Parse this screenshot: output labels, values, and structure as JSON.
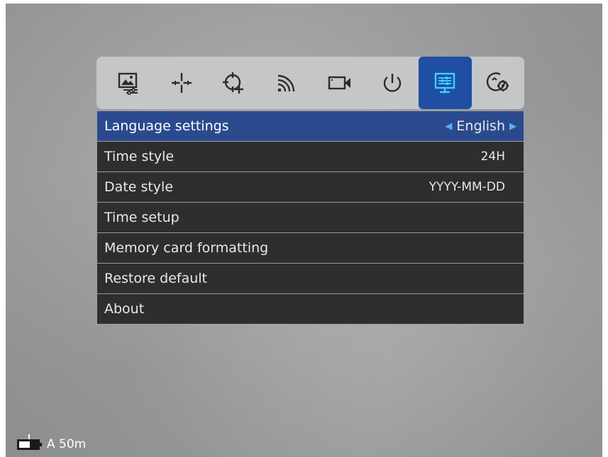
{
  "icons": {
    "tabs": [
      {
        "id": "image",
        "icon": "image-settings-icon"
      },
      {
        "id": "crosshair",
        "icon": "crosshair-icon"
      },
      {
        "id": "target",
        "icon": "target-icon"
      },
      {
        "id": "wifi",
        "icon": "wireless-icon"
      },
      {
        "id": "record",
        "icon": "video-camera-icon"
      },
      {
        "id": "power",
        "icon": "power-icon"
      },
      {
        "id": "display",
        "icon": "display-settings-icon",
        "active": true
      },
      {
        "id": "system",
        "icon": "system-settings-icon"
      }
    ],
    "active_color": "#1e4fa3"
  },
  "menu": {
    "rows": [
      {
        "label": "Language settings",
        "value": "English",
        "selected": true
      },
      {
        "label": "Time style",
        "value": "24H"
      },
      {
        "label": "Date style",
        "value": "YYYY-MM-DD"
      },
      {
        "label": "Time setup",
        "value": ""
      },
      {
        "label": "Memory card formatting",
        "value": ""
      },
      {
        "label": "Restore default",
        "value": ""
      },
      {
        "label": "About",
        "value": ""
      }
    ],
    "selected_color": "#2b4a8e"
  },
  "status": {
    "range": "A 50m",
    "battery_level": 0.55
  }
}
